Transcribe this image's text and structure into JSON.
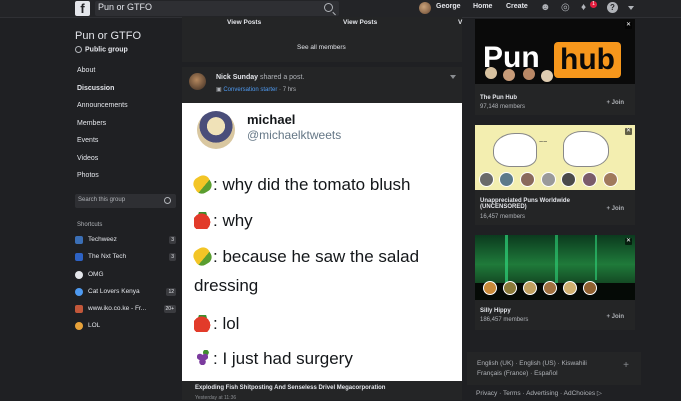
{
  "topbar": {
    "logo": "f",
    "search_value": "Pun or GTFO",
    "user_name": "George",
    "home_label": "Home",
    "create_label": "Create",
    "notifications_count": "1",
    "help_label": "?"
  },
  "group": {
    "title": "Pun or GTFO",
    "privacy": "Public group",
    "nav": [
      "About",
      "Discussion",
      "Announcements",
      "Members",
      "Events",
      "Videos",
      "Photos"
    ],
    "search_placeholder": "Search this group"
  },
  "shortcuts": {
    "heading": "Shortcuts",
    "items": [
      {
        "label": "Techweez",
        "count": "3",
        "color": "#3b6fb6"
      },
      {
        "label": "The Nxt Tech",
        "count": "3",
        "color": "#2d62c4"
      },
      {
        "label": "OMG",
        "count": "",
        "color": "#e4e6eb"
      },
      {
        "label": "Cat Lovers Kenya",
        "count": "12",
        "color": "#4e9af1"
      },
      {
        "label": "www.iko.co.ke - Fr...",
        "count": "20+",
        "color": "#c2573a"
      },
      {
        "label": "LOL",
        "count": "",
        "color": "#e8a23a"
      }
    ]
  },
  "feed": {
    "view_posts_1": "View Posts",
    "view_posts_2": "View Posts",
    "view_posts_3": "V",
    "see_all": "See all members",
    "post": {
      "author": "Nick Sunday",
      "action": "shared a post.",
      "badge": "Conversation starter",
      "time": "· 7 hrs"
    },
    "tweet": {
      "name": "michael",
      "handle": "@michaelktweets",
      "lines": [
        {
          "emoji": "corn",
          "text": ": why did the tomato blush"
        },
        {
          "emoji": "tomato",
          "text": ": why"
        },
        {
          "emoji": "corn",
          "text": ": because he saw the salad"
        },
        {
          "emoji": "",
          "text": "dressing"
        },
        {
          "emoji": "tomato",
          "text": ": lol"
        },
        {
          "emoji": "grapes",
          "text": ": I just had surgery"
        }
      ]
    },
    "next_post_title": "Exploding Fish Shitposting And Senseless Drivel Megacorporation",
    "next_post_sub": "Yesterday at 11:36"
  },
  "suggestions": [
    {
      "name": "The Pun Hub",
      "members": "97,148 members",
      "join": "+ Join",
      "logo_left": "Pun",
      "logo_right": "hub"
    },
    {
      "name": "Unappreciated Puns Worldwide (UNCENSORED)",
      "members": "16,457 members",
      "join": "+ Join"
    },
    {
      "name": "Silly Hippy",
      "members": "186,457 members",
      "join": "+ Join"
    }
  ],
  "languages": {
    "row1": "English (UK) · English (US) · Kiswahili",
    "row2": "Français (France) · Español"
  },
  "footer": "Privacy · Terms · Advertising · AdChoices ▷"
}
